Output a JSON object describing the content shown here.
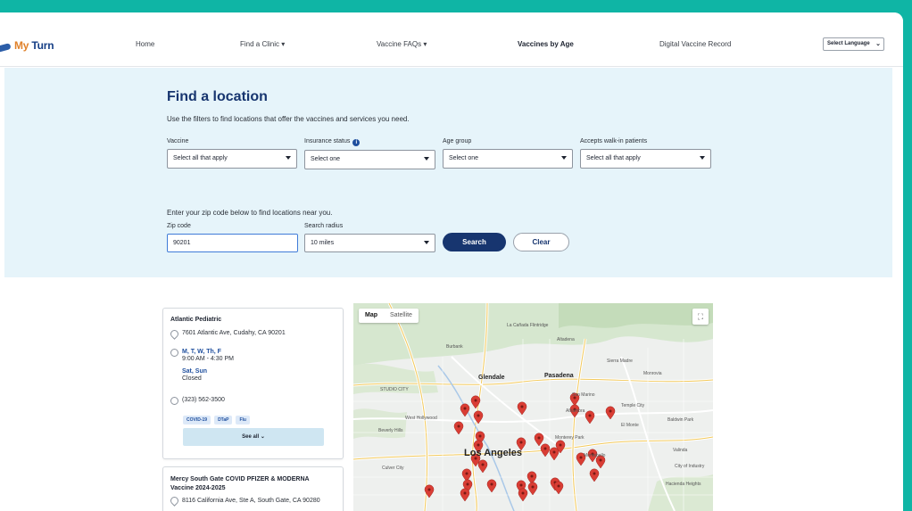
{
  "header": {
    "logo_my": "My",
    "logo_turn": " Turn",
    "nav": [
      "Home",
      "Find a Clinic ▾",
      "Vaccine FAQs ▾",
      "Vaccines by Age",
      "Digital Vaccine Record"
    ],
    "language_select": "Select Language"
  },
  "search": {
    "title": "Find a location",
    "intro": "Use the filters to find locations that offer the vaccines and services you need.",
    "filters": {
      "vaccine_label": "Vaccine",
      "vaccine_value": "Select all that apply",
      "insurance_label": "Insurance status",
      "insurance_value": "Select one",
      "age_label": "Age group",
      "age_value": "Select one",
      "walkin_label": "Accepts walk-in patients",
      "walkin_value": "Select all that apply"
    },
    "zip_message": "Enter your zip code below to find locations near you.",
    "zip_label": "Zip code",
    "zip_value": "90201",
    "radius_label": "Search radius",
    "radius_value": "10 miles",
    "search_button": "Search",
    "clear_button": "Clear"
  },
  "results": [
    {
      "name": "Atlantic Pediatric",
      "address": "7601 Atlantic Ave, Cudahy, CA 90201",
      "days_open": "M, T, W, Th, F",
      "hours_open": "9:00 AM - 4:30 PM",
      "days_closed": "Sat, Sun",
      "closed_text": "Closed",
      "phone": "(323) 562-3500",
      "tags": [
        "COVID-19",
        "DTaP",
        "Flu"
      ],
      "see_all": "See all ⌄"
    },
    {
      "name": "Mercy South Gate COVID PFIZER & MODERNA Vaccine 2024-2025",
      "address": "8116 California Ave, Ste A, South Gate, CA 90280"
    }
  ],
  "map": {
    "type_map": "Map",
    "type_satellite": "Satellite",
    "labels": {
      "burbank": "Burbank",
      "glendale": "Glendale",
      "pasadena": "Pasadena",
      "los_angeles": "Los Angeles",
      "altadena": "Altadena",
      "la_canada": "La Cañada Flintridge",
      "sierra_madre": "Sierra Madre",
      "monrovia": "Monrovia",
      "san_marino": "San Marino",
      "alhambra": "Alhambra",
      "temple_city": "Temple City",
      "monterey_park": "Monterey Park",
      "baldwin_park": "Baldwin Park",
      "west_hollywood": "West Hollywood",
      "beverly_hills": "Beverly Hills",
      "culver_city": "Culver City",
      "el_monte": "El Monte",
      "city_of_industry": "City of Industry",
      "hacienda_heights": "Hacienda Heights",
      "valinda": "Valinda",
      "studio_city": "STUDIO CITY",
      "montebello": "Montebello"
    }
  },
  "colors": {
    "brand_teal": "#0fb5a5",
    "brand_navy": "#17356f",
    "band_bg": "#e6f4fa",
    "pin_red": "#d93d34"
  }
}
